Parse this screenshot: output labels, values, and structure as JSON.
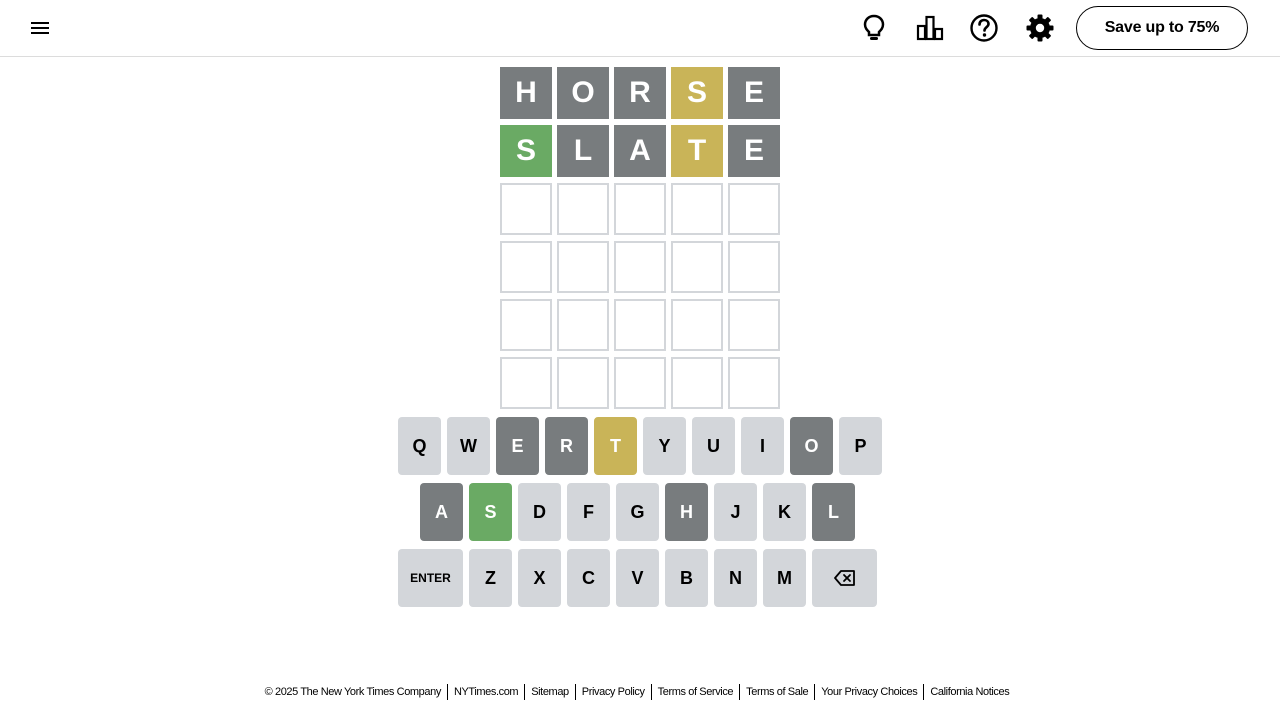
{
  "header": {
    "menu_icon": "hamburger-menu-icon",
    "tools": [
      {
        "name": "hint-lightbulb-icon"
      },
      {
        "name": "stats-bar-chart-icon"
      },
      {
        "name": "help-question-icon"
      },
      {
        "name": "settings-gear-icon"
      }
    ],
    "save_label": "Save up to 75%"
  },
  "colors": {
    "absent": "#787c7e",
    "present": "#c9b458",
    "correct": "#6aaa64",
    "empty_border": "#d3d6da",
    "key_default": "#d3d6da"
  },
  "board": {
    "rows": [
      [
        {
          "letter": "H",
          "state": "absent"
        },
        {
          "letter": "O",
          "state": "absent"
        },
        {
          "letter": "R",
          "state": "absent"
        },
        {
          "letter": "S",
          "state": "present"
        },
        {
          "letter": "E",
          "state": "absent"
        }
      ],
      [
        {
          "letter": "S",
          "state": "correct"
        },
        {
          "letter": "L",
          "state": "absent"
        },
        {
          "letter": "A",
          "state": "absent"
        },
        {
          "letter": "T",
          "state": "present"
        },
        {
          "letter": "E",
          "state": "absent"
        }
      ],
      [
        {
          "letter": "",
          "state": "empty"
        },
        {
          "letter": "",
          "state": "empty"
        },
        {
          "letter": "",
          "state": "empty"
        },
        {
          "letter": "",
          "state": "empty"
        },
        {
          "letter": "",
          "state": "empty"
        }
      ],
      [
        {
          "letter": "",
          "state": "empty"
        },
        {
          "letter": "",
          "state": "empty"
        },
        {
          "letter": "",
          "state": "empty"
        },
        {
          "letter": "",
          "state": "empty"
        },
        {
          "letter": "",
          "state": "empty"
        }
      ],
      [
        {
          "letter": "",
          "state": "empty"
        },
        {
          "letter": "",
          "state": "empty"
        },
        {
          "letter": "",
          "state": "empty"
        },
        {
          "letter": "",
          "state": "empty"
        },
        {
          "letter": "",
          "state": "empty"
        }
      ],
      [
        {
          "letter": "",
          "state": "empty"
        },
        {
          "letter": "",
          "state": "empty"
        },
        {
          "letter": "",
          "state": "empty"
        },
        {
          "letter": "",
          "state": "empty"
        },
        {
          "letter": "",
          "state": "empty"
        }
      ]
    ]
  },
  "keyboard": {
    "rows": [
      [
        {
          "label": "Q",
          "state": "default"
        },
        {
          "label": "W",
          "state": "default"
        },
        {
          "label": "E",
          "state": "absent"
        },
        {
          "label": "R",
          "state": "absent"
        },
        {
          "label": "T",
          "state": "present"
        },
        {
          "label": "Y",
          "state": "default"
        },
        {
          "label": "U",
          "state": "default"
        },
        {
          "label": "I",
          "state": "default"
        },
        {
          "label": "O",
          "state": "absent"
        },
        {
          "label": "P",
          "state": "default"
        }
      ],
      [
        {
          "label": "A",
          "state": "absent"
        },
        {
          "label": "S",
          "state": "correct"
        },
        {
          "label": "D",
          "state": "default"
        },
        {
          "label": "F",
          "state": "default"
        },
        {
          "label": "G",
          "state": "default"
        },
        {
          "label": "H",
          "state": "absent"
        },
        {
          "label": "J",
          "state": "default"
        },
        {
          "label": "K",
          "state": "default"
        },
        {
          "label": "L",
          "state": "absent"
        }
      ],
      [
        {
          "label": "ENTER",
          "state": "default",
          "wide": true
        },
        {
          "label": "Z",
          "state": "default"
        },
        {
          "label": "X",
          "state": "default"
        },
        {
          "label": "C",
          "state": "default"
        },
        {
          "label": "V",
          "state": "default"
        },
        {
          "label": "B",
          "state": "default"
        },
        {
          "label": "N",
          "state": "default"
        },
        {
          "label": "M",
          "state": "default"
        },
        {
          "label": "",
          "icon": "backspace-icon",
          "state": "default",
          "wide": true
        }
      ]
    ]
  },
  "footer": {
    "copyright": "© 2025 The New York Times Company",
    "links": [
      "NYTimes.com",
      "Sitemap",
      "Privacy Policy",
      "Terms of Service",
      "Terms of Sale",
      "Your Privacy Choices",
      "California Notices"
    ]
  }
}
